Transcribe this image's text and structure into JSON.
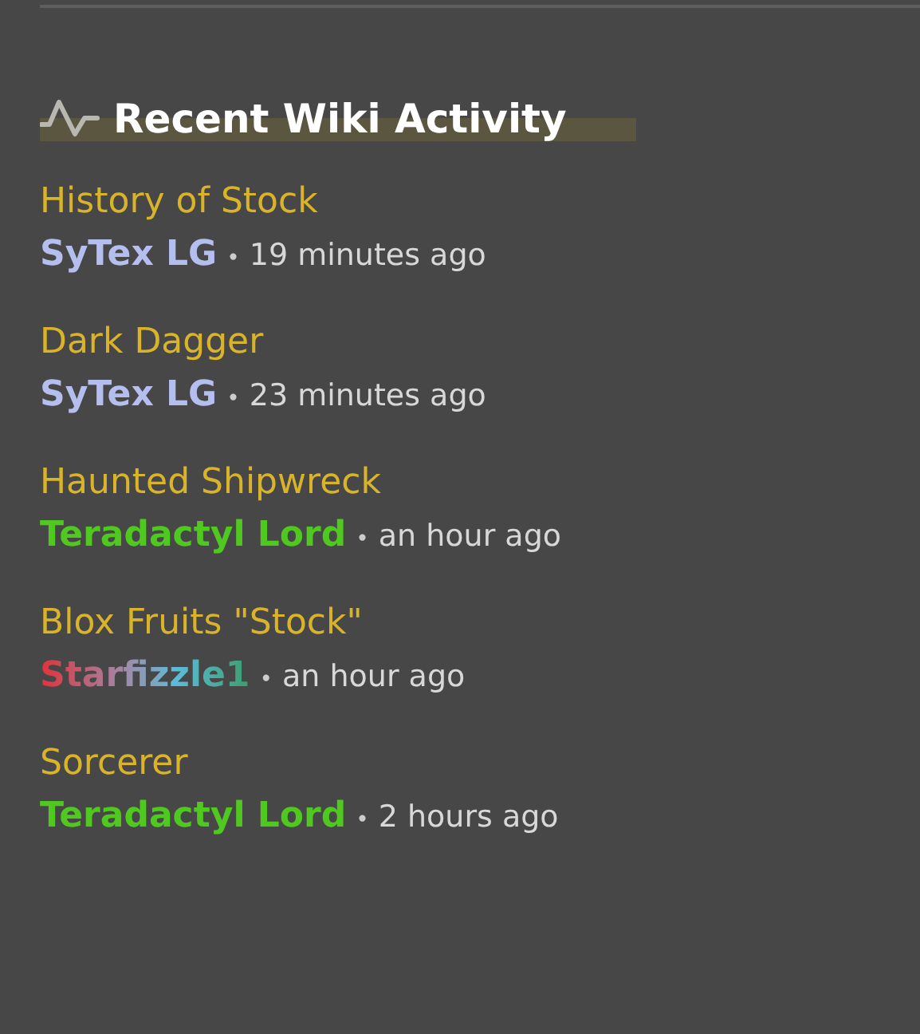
{
  "heading": "Recent Wiki Activity",
  "items": [
    {
      "title": "History of Stock",
      "user": "SyTex LG",
      "kind": "solid",
      "color": "#b4bff0",
      "separator": "•",
      "time": "19 minutes ago"
    },
    {
      "title": "Dark Dagger",
      "user": "SyTex LG",
      "kind": "solid",
      "color": "#b4bff0",
      "separator": "•",
      "time": "23 minutes ago"
    },
    {
      "title": "Haunted Shipwreck",
      "user": "Teradactyl Lord",
      "kind": "solid",
      "color": "#4fc820",
      "separator": "•",
      "time": "an hour ago"
    },
    {
      "title": "Blox Fruits \"Stock\"",
      "user": "Starfizzle1",
      "kind": "gradient",
      "separator": "•",
      "time": "an hour ago"
    },
    {
      "title": "Sorcerer",
      "user": "Teradactyl Lord",
      "kind": "solid",
      "color": "#4fc820",
      "separator": "•",
      "time": "2 hours ago"
    }
  ]
}
